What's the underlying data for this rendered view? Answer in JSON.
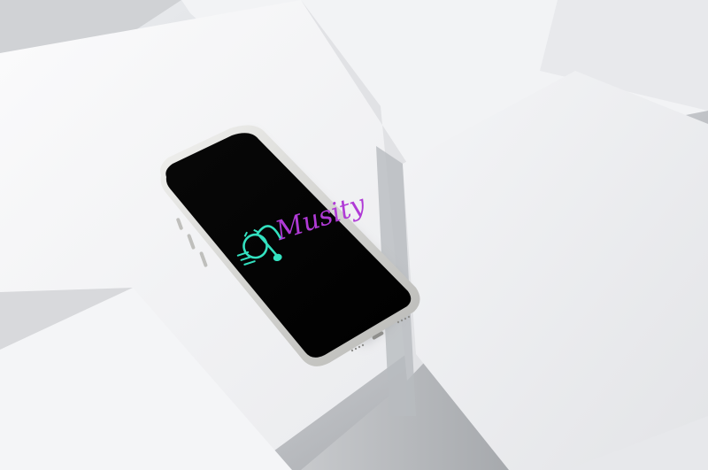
{
  "logo": {
    "text": "Musity",
    "colors": {
      "icon": "#33e1c0",
      "wordmark": "#b03ad6"
    }
  },
  "colors": {
    "background_light": "#f3f4f6",
    "background_shadow": "#8e9094",
    "screen": "#030303",
    "phone_frame": "#d8d8d6"
  }
}
